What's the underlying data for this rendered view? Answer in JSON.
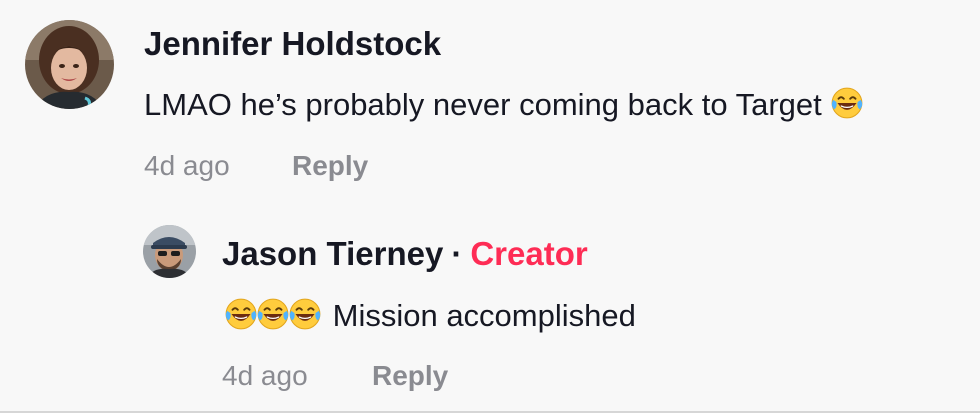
{
  "comments": [
    {
      "author": "Jennifer Holdstock",
      "text": "LMAO he’s probably never coming back to Target",
      "text_emoji": "face-with-tears-of-joy",
      "time": "4d ago",
      "reply_label": "Reply"
    }
  ],
  "reply": {
    "author": "Jason Tierney",
    "separator": "·",
    "badge": "Creator",
    "text_emoji": [
      "face-with-tears-of-joy",
      "face-with-tears-of-joy",
      "face-with-tears-of-joy"
    ],
    "text": "Mission accomplished",
    "time": "4d ago",
    "reply_label": "Reply"
  },
  "colors": {
    "background": "#f8f8f8",
    "creator_badge": "#fe2c55",
    "meta_text": "#8a8b91",
    "primary_text": "#161823"
  }
}
